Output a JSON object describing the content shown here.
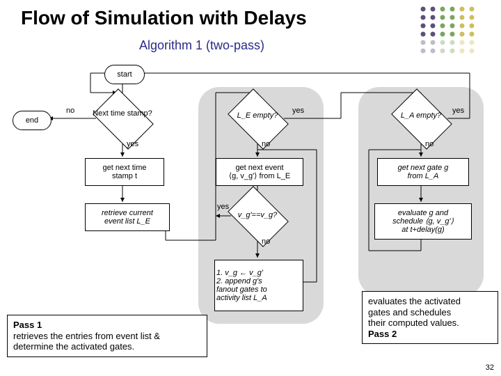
{
  "title": "Flow of Simulation with Delays",
  "subtitle": "Algorithm 1 (two-pass)",
  "decor": {
    "rows": 6,
    "cols": 6,
    "colors": [
      "#4a3d6b",
      "#4a3d6b",
      "#6b9b4a",
      "#6b9b4a",
      "#c9b84a",
      "#c9b84a"
    ]
  },
  "nodes": {
    "start": "start",
    "end": "end",
    "q_next_ts": "Next  time\nstamp?",
    "get_next_ts": "get next time\nstamp t",
    "retrieve_list": "retrieve current\nevent list L_E",
    "q_le_empty": "L_E\nempty?",
    "get_next_event": "get next event\n⟨g, v_g'⟩ from L_E",
    "q_vg_eq": "v_g'==v_g?",
    "steps": "1. v_g ← v_g'\n2. append g's\n    fanout gates to\n    activity list L_A",
    "q_la_empty": "L_A\nempty?",
    "get_next_gate": "get next gate g\nfrom L_A",
    "eval_schedule": "evaluate g and\nschedule ⟨g, v_g'⟩\nat t+delay(g)"
  },
  "labels": {
    "yes": "yes",
    "no": "no"
  },
  "callouts": {
    "pass1_title": "Pass 1",
    "pass1_body": "retrieves the entries from event list &\ndetermine the activated gates.",
    "pass2_title": "Pass 2",
    "pass2_body": "evaluates the activated\ngates and schedules\ntheir computed values."
  },
  "pagenum": "32"
}
